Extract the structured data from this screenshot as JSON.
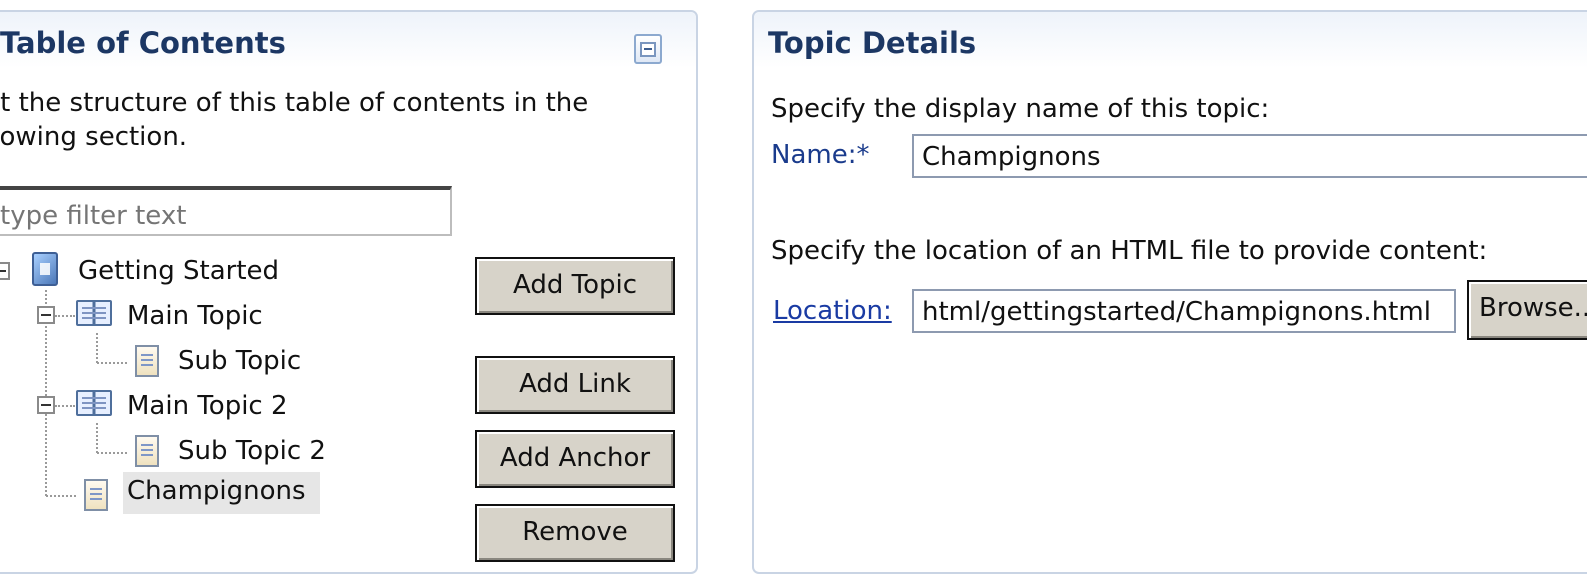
{
  "toc": {
    "title": "Table of Contents",
    "description_line1": "Edit the structure of this table of contents in the",
    "description_line2": "following section.",
    "filter_placeholder": "type filter text",
    "tree": {
      "root": "Getting Started",
      "main_topic": "Main Topic",
      "sub_topic": "Sub Topic",
      "main_topic_2": "Main Topic 2",
      "sub_topic_2": "Sub Topic 2",
      "champignons": "Champignons"
    },
    "buttons": {
      "add_topic": "Add Topic",
      "add_link": "Add Link",
      "add_anchor": "Add Anchor",
      "remove": "Remove"
    }
  },
  "details": {
    "title": "Topic Details",
    "name_prompt": "Specify the display name of this topic:",
    "name_label": "Name:*",
    "name_value": "Champignons",
    "location_prompt": "Specify the location of an HTML file to provide content:",
    "location_label": "Location:",
    "location_value": "html/gettingstarted/Champignons.html",
    "browse_label": "Browse..."
  },
  "colors": {
    "section_title": "#1c3764",
    "link": "#1a3ba3",
    "button_face": "#d7d3c9",
    "selection": "#e6e6e6"
  }
}
